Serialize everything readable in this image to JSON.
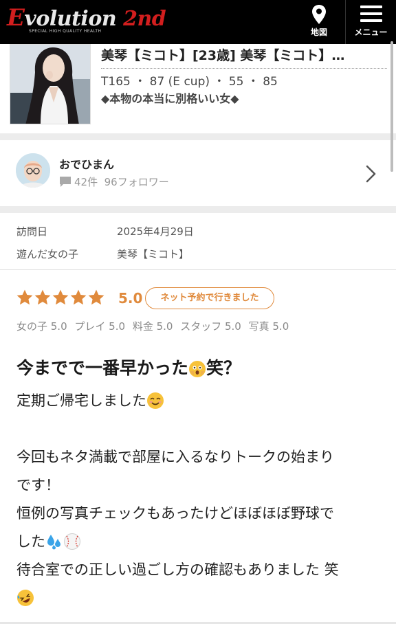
{
  "header": {
    "logo_main": "Evolution",
    "logo_suffix": "2nd",
    "logo_sub": "SPECIAL HIGH QUALITY HEALTH",
    "map_label": "地図",
    "menu_label": "メニュー"
  },
  "cast": {
    "title": "美琴【ミコト】[23歳] 美琴【ミコト】…",
    "size": "T165 ・ 87 (E cup) ・ 55 ・ 85",
    "catch": "◆本物の本当に別格いい女◆"
  },
  "reviewer": {
    "name": "おでひまん",
    "posts": "42件",
    "followers": "96フォロワー"
  },
  "info": {
    "visit_label": "訪問日",
    "visit_value": "2025年4月29日",
    "girl_label": "遊んだ女の子",
    "girl_value": "美琴【ミコト】"
  },
  "rating": {
    "stars": 5,
    "score": "5.0",
    "badge": "ネット予約で行きました",
    "sub_scores": [
      "女の子 5.0",
      "プレイ 5.0",
      "料金 5.0",
      "スタッフ 5.0",
      "写真 5.0"
    ]
  },
  "review": {
    "title_a": "今までで一番早かった",
    "title_b": "笑？",
    "line1": "定期ご帰宅しました",
    "line2": "今回もネタ満載で部屋に入るなりトークの始まり",
    "line3": "です！",
    "line4": "恒例の写真チェックもあったけどほぼほぼ野球で",
    "line5": "した",
    "line6": "待合室での正しい過ごし方の確認もありました 笑"
  },
  "colors": {
    "accent": "#e08a3c",
    "header_bg": "#000000",
    "logo_red": "#d21e1e",
    "separator": "#ececec"
  },
  "icons": [
    "map-pin-icon",
    "hamburger-menu-icon",
    "comment-icon",
    "chevron-right-icon",
    "star-icon",
    "flushed-emoji-icon",
    "smiling-emoji-icon",
    "sweat-droplets-emoji-icon",
    "baseball-emoji-icon",
    "rofl-emoji-icon"
  ]
}
